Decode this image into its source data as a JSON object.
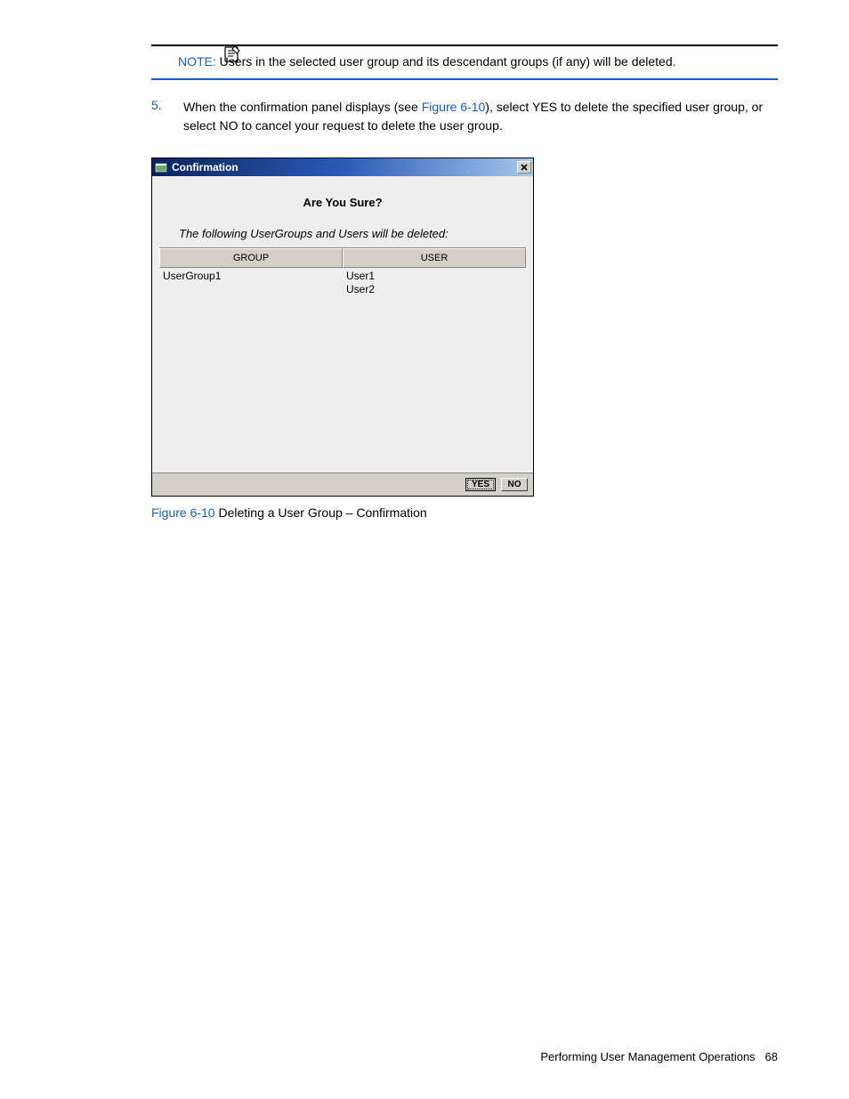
{
  "note": {
    "label": "NOTE:",
    "text": "Users in the selected user group and its descendant groups (if any) will be deleted."
  },
  "step": {
    "number": "5.",
    "before_link": "When the confirmation panel displays (see ",
    "link": "Figure 6-10",
    "after_link": "), select YES to delete the specified user group, or select NO to cancel your request to delete the user group."
  },
  "dialog": {
    "title": "Confirmation",
    "heading": "Are You Sure?",
    "subtext": "The following UserGroups and Users will be deleted:",
    "columns": {
      "group": "GROUP",
      "user": "USER"
    },
    "rows": {
      "group": [
        "UserGroup1"
      ],
      "user": [
        "User1",
        "User2"
      ]
    },
    "buttons": {
      "yes": "YES",
      "no": "NO"
    }
  },
  "caption": {
    "link": "Figure 6-10",
    "text": " Deleting a User Group – Confirmation"
  },
  "footer": {
    "section": "Performing User Management Operations",
    "page": "68"
  }
}
